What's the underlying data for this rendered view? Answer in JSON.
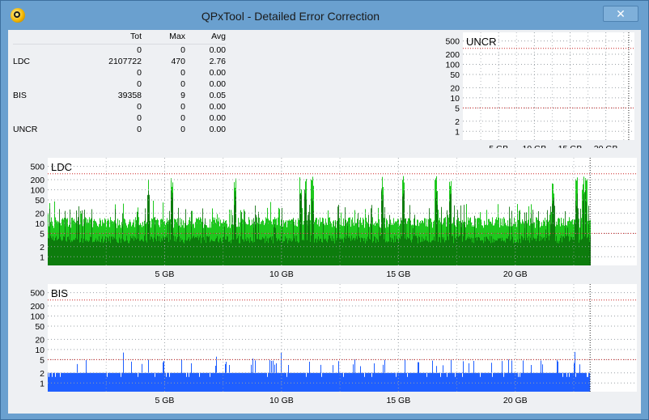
{
  "window": {
    "title": "QPxTool - Detailed Error Correction",
    "close_glyph": "✕"
  },
  "stats": {
    "headers": [
      "",
      "Tot",
      "Max",
      "Avg"
    ],
    "rows": [
      [
        "",
        "0",
        "0",
        "0.00"
      ],
      [
        "LDC",
        "2107722",
        "470",
        "2.76"
      ],
      [
        "",
        "0",
        "0",
        "0.00"
      ],
      [
        "",
        "0",
        "0",
        "0.00"
      ],
      [
        "BIS",
        "39358",
        "9",
        "0.05"
      ],
      [
        "",
        "0",
        "0",
        "0.00"
      ],
      [
        "",
        "0",
        "0",
        "0.00"
      ],
      [
        "UNCR",
        "0",
        "0",
        "0.00"
      ]
    ]
  },
  "colors": {
    "ldc_light": "#1ec81e",
    "ldc_dark": "#0a6e0a",
    "bis": "#1f5fff",
    "threshold": "#cc2222",
    "grid": "#9aa0a6"
  },
  "chart_data": [
    {
      "type": "area",
      "title": "UNCR",
      "y_scale": "log",
      "y_ticks": [
        1,
        2,
        5,
        10,
        20,
        50,
        100,
        200,
        500
      ],
      "x_ticks": [
        "5 GB",
        "10 GB",
        "15 GB",
        "20 GB"
      ],
      "x_tick_values": [
        5,
        10,
        15,
        20
      ],
      "xlim": [
        0,
        24
      ],
      "thresholds": [
        5,
        300
      ],
      "series": [
        {
          "values": []
        }
      ],
      "grid": true
    },
    {
      "type": "area",
      "title": "LDC",
      "y_scale": "log",
      "y_ticks": [
        1,
        2,
        5,
        10,
        20,
        50,
        100,
        200,
        500
      ],
      "x_ticks": [
        "5 GB",
        "10 GB",
        "15 GB",
        "20 GB"
      ],
      "x_tick_values": [
        5,
        10,
        15,
        20
      ],
      "xlim": [
        0,
        25.2
      ],
      "data_end": 23.2,
      "thresholds": [
        5,
        300
      ],
      "typical_level": 9,
      "max_value": 470,
      "series": [
        {
          "x": [
            0,
            2,
            4,
            6,
            8,
            10,
            12,
            14,
            16,
            18,
            20,
            22,
            23.2
          ],
          "values": [
            9,
            9,
            9,
            8,
            9,
            9,
            9,
            9,
            9,
            8,
            9,
            11,
            12
          ]
        }
      ],
      "grid": true
    },
    {
      "type": "bar",
      "title": "BIS",
      "y_scale": "log",
      "y_ticks": [
        1,
        2,
        5,
        10,
        20,
        50,
        100,
        200,
        500
      ],
      "x_ticks": [
        "5 GB",
        "10 GB",
        "15 GB",
        "20 GB"
      ],
      "x_tick_values": [
        5,
        10,
        15,
        20
      ],
      "xlim": [
        0,
        25.2
      ],
      "data_end": 23.2,
      "thresholds": [
        5,
        300
      ],
      "typical_level": 2,
      "max_value": 9,
      "grid": true
    }
  ]
}
